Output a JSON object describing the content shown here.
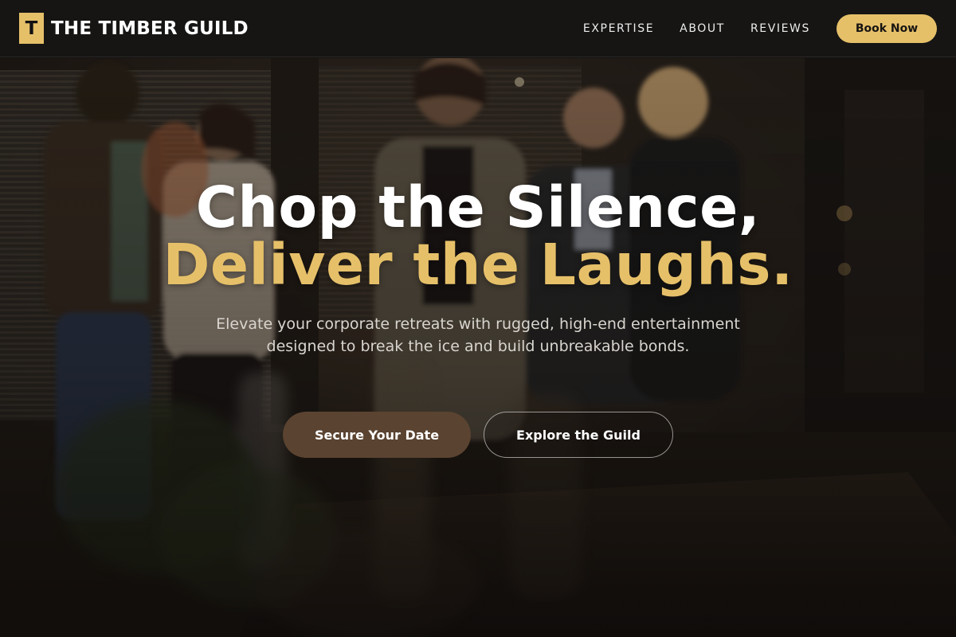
{
  "nav": {
    "brand_mark": "T",
    "brand_name": "THE TIMBER GUILD",
    "links": [
      {
        "label": "EXPERTISE"
      },
      {
        "label": "ABOUT"
      },
      {
        "label": "REVIEWS"
      }
    ],
    "cta_label": "Book Now"
  },
  "hero": {
    "headline_line1": "Chop the Silence,",
    "headline_line2": "Deliver the Laughs.",
    "subtext": "Elevate your corporate retreats with rugged, high-end entertainment designed to break the ice and build unbreakable bonds.",
    "primary_cta": "Secure Your Date",
    "secondary_cta": "Explore the Guild",
    "background_image": "people-socializing-at-evening-gathering"
  },
  "colors": {
    "accent_gold": "#e6c069",
    "nav_background": "#161514",
    "primary_button": "#5a4330",
    "hero_text": "#ffffff",
    "subtext": "#d9d5cf"
  }
}
